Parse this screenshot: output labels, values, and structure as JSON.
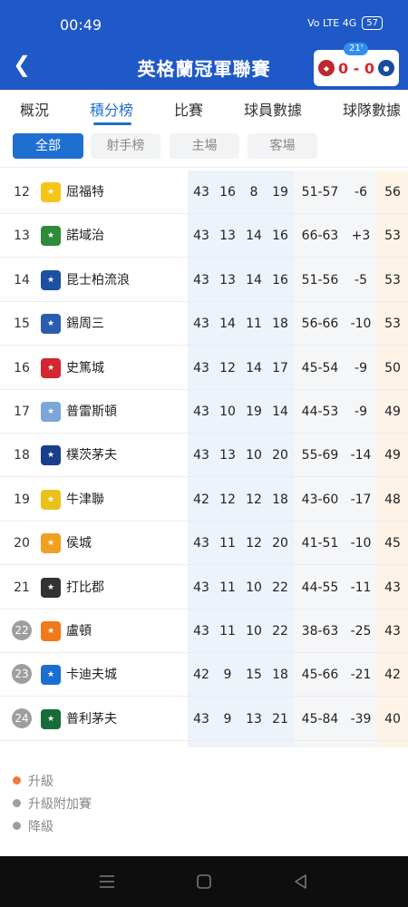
{
  "status": {
    "time": "00:49",
    "signal": "Vo LTE 4G",
    "battery": "57"
  },
  "header": {
    "title": "英格蘭冠軍聯賽",
    "match": {
      "minute": "21'",
      "score": "0 - 0",
      "home_color": "#c0262d",
      "away_color": "#1b4aa1"
    }
  },
  "tabs": [
    {
      "label": "概況"
    },
    {
      "label": "積分榜"
    },
    {
      "label": "比賽"
    },
    {
      "label": "球員數據"
    },
    {
      "label": "球隊數據"
    }
  ],
  "active_tab": "積分榜",
  "filters": [
    {
      "label": "全部"
    },
    {
      "label": "射手榜"
    },
    {
      "label": "主場"
    },
    {
      "label": "客場"
    }
  ],
  "standings": [
    {
      "rank": "12",
      "name": "屈福特",
      "played": "43",
      "won": "16",
      "drawn": "8",
      "lost": "19",
      "gfga": "51-57",
      "gd": "-6",
      "pts": "56",
      "crest_color": "#f5c518"
    },
    {
      "rank": "13",
      "name": "諾域治",
      "played": "43",
      "won": "13",
      "drawn": "14",
      "lost": "16",
      "gfga": "66-63",
      "gd": "+3",
      "pts": "53",
      "crest_color": "#2e8b3a"
    },
    {
      "rank": "14",
      "name": "昆士柏流浪",
      "played": "43",
      "won": "13",
      "drawn": "14",
      "lost": "16",
      "gfga": "51-56",
      "gd": "-5",
      "pts": "53",
      "crest_color": "#1d4fa3"
    },
    {
      "rank": "15",
      "name": "錫周三",
      "played": "43",
      "won": "14",
      "drawn": "11",
      "lost": "18",
      "gfga": "56-66",
      "gd": "-10",
      "pts": "53",
      "crest_color": "#2a5db0"
    },
    {
      "rank": "16",
      "name": "史篤城",
      "played": "43",
      "won": "12",
      "drawn": "14",
      "lost": "17",
      "gfga": "45-54",
      "gd": "-9",
      "pts": "50",
      "crest_color": "#d22630"
    },
    {
      "rank": "17",
      "name": "普雷斯頓",
      "played": "43",
      "won": "10",
      "drawn": "19",
      "lost": "14",
      "gfga": "44-53",
      "gd": "-9",
      "pts": "49",
      "crest_color": "#7aa6d8"
    },
    {
      "rank": "18",
      "name": "樸茨茅夫",
      "played": "43",
      "won": "13",
      "drawn": "10",
      "lost": "20",
      "gfga": "55-69",
      "gd": "-14",
      "pts": "49",
      "crest_color": "#1a3e8c"
    },
    {
      "rank": "19",
      "name": "牛津聯",
      "played": "42",
      "won": "12",
      "drawn": "12",
      "lost": "18",
      "gfga": "43-60",
      "gd": "-17",
      "pts": "48",
      "crest_color": "#e8c21a"
    },
    {
      "rank": "20",
      "name": "侯城",
      "played": "43",
      "won": "11",
      "drawn": "12",
      "lost": "20",
      "gfga": "41-51",
      "gd": "-10",
      "pts": "45",
      "crest_color": "#f0a020"
    },
    {
      "rank": "21",
      "name": "打比郡",
      "played": "43",
      "won": "11",
      "drawn": "10",
      "lost": "22",
      "gfga": "44-55",
      "gd": "-11",
      "pts": "43",
      "crest_color": "#333333"
    },
    {
      "rank": "22",
      "name": "盧頓",
      "played": "43",
      "won": "11",
      "drawn": "10",
      "lost": "22",
      "gfga": "38-63",
      "gd": "-25",
      "pts": "43",
      "crest_color": "#f07a1a",
      "zone": "relegation"
    },
    {
      "rank": "23",
      "name": "卡迪夫城",
      "played": "42",
      "won": "9",
      "drawn": "15",
      "lost": "18",
      "gfga": "45-66",
      "gd": "-21",
      "pts": "42",
      "crest_color": "#1b6fd0",
      "zone": "relegation"
    },
    {
      "rank": "24",
      "name": "普利茅夫",
      "played": "43",
      "won": "9",
      "drawn": "13",
      "lost": "21",
      "gfga": "45-84",
      "gd": "-39",
      "pts": "40",
      "crest_color": "#1a6b3a",
      "zone": "relegation"
    }
  ],
  "legend": [
    {
      "label": "升級",
      "color": "#f07a3a"
    },
    {
      "label": "升級附加賽",
      "color": "#9e9e9e"
    },
    {
      "label": "降級",
      "color": "#9e9e9e"
    }
  ],
  "colors": {
    "brand": "#1f58c7",
    "accent": "#1f6fd1",
    "points_bg": "#fdf3e6"
  }
}
